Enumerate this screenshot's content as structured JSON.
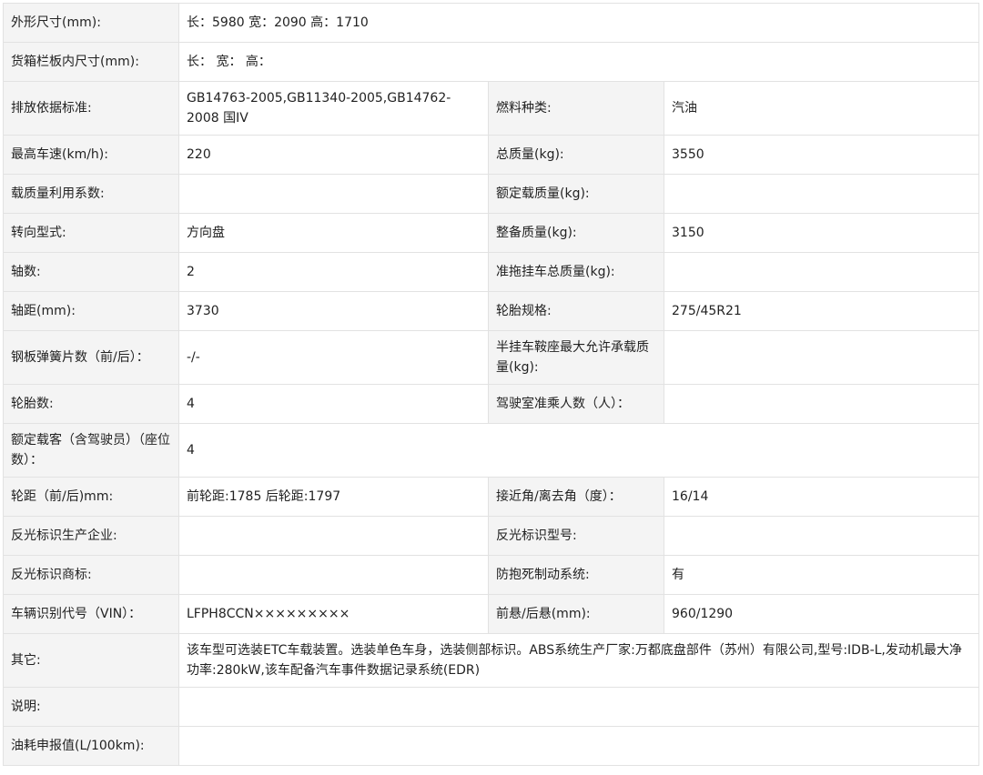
{
  "rows": [
    {
      "type": "full",
      "label": "外形尺寸(mm):",
      "value": "长：5980 宽：2090 高：1710"
    },
    {
      "type": "full",
      "label": "货箱栏板内尺寸(mm):",
      "value": "长：  宽：  高："
    },
    {
      "type": "pair",
      "label1": "排放依据标准:",
      "value1": "GB14763-2005,GB11340-2005,GB14762-2008 国IV",
      "label2": "燃料种类:",
      "value2": "汽油"
    },
    {
      "type": "pair",
      "label1": "最高车速(km/h):",
      "value1": "220",
      "label2": "总质量(kg):",
      "value2": "3550"
    },
    {
      "type": "pair",
      "label1": "载质量利用系数:",
      "value1": "",
      "label2": "额定载质量(kg):",
      "value2": ""
    },
    {
      "type": "pair",
      "label1": "转向型式:",
      "value1": "方向盘",
      "label2": "整备质量(kg):",
      "value2": "3150"
    },
    {
      "type": "pair",
      "label1": "轴数:",
      "value1": "2",
      "label2": "准拖挂车总质量(kg):",
      "value2": ""
    },
    {
      "type": "pair",
      "label1": "轴距(mm):",
      "value1": "3730",
      "label2": "轮胎规格:",
      "value2": "275/45R21"
    },
    {
      "type": "pair",
      "label1": "钢板弹簧片数（前/后）：",
      "value1": "-/-",
      "label2": "半挂车鞍座最大允许承载质量(kg):",
      "value2": ""
    },
    {
      "type": "pair",
      "label1": "轮胎数:",
      "value1": "4",
      "label2": "驾驶室准乘人数（人）：",
      "value2": ""
    },
    {
      "type": "full",
      "label": "额定载客（含驾驶员）（座位数）：",
      "value": "4"
    },
    {
      "type": "pair",
      "label1": "轮距（前/后)mm:",
      "value1": "前轮距:1785 后轮距:1797",
      "label2": "接近角/离去角（度）：",
      "value2": "16/14"
    },
    {
      "type": "pair",
      "label1": "反光标识生产企业:",
      "value1": "",
      "label2": "反光标识型号:",
      "value2": ""
    },
    {
      "type": "pair",
      "label1": "反光标识商标:",
      "value1": "",
      "label2": "防抱死制动系统:",
      "value2": "有"
    },
    {
      "type": "pair",
      "label1": "车辆识别代号（VIN）：",
      "value1": "LFPH8CCN×××××××××",
      "label2": "前悬/后悬(mm):",
      "value2": "960/1290"
    },
    {
      "type": "full",
      "label": "其它:",
      "value": "该车型可选装ETC车载装置。选装单色车身，选装侧部标识。ABS系统生产厂家:万都底盘部件（苏州）有限公司,型号:IDB-L,发动机最大净功率:280kW,该车配备汽车事件数据记录系统(EDR)"
    },
    {
      "type": "full",
      "label": "说明:",
      "value": ""
    },
    {
      "type": "full",
      "label": "油耗申报值(L/100km):",
      "value": ""
    }
  ]
}
